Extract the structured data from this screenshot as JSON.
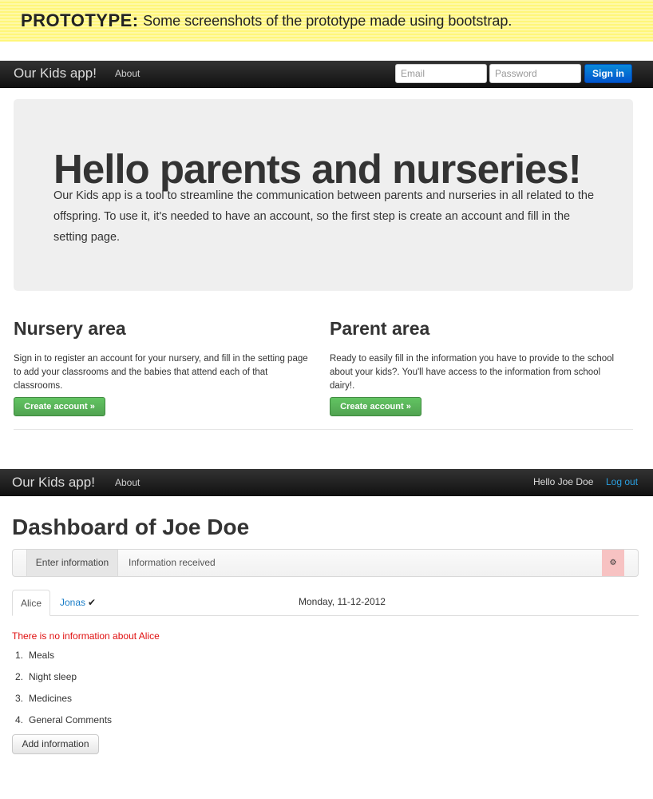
{
  "banner": {
    "title": "PROTOTYPE",
    "colon": ":",
    "text": "Some screenshots of the prototype made using bootstrap."
  },
  "nav1": {
    "brand": "Our Kids app!",
    "about": "About",
    "email_placeholder": "Email",
    "password_placeholder": "Password",
    "signin": "Sign in"
  },
  "hero": {
    "title": "Hello parents and nurseries!",
    "text": "Our Kids app is a tool to streamline the communication between parents and nurseries in all related to the offspring. To use it, it's needed to have an account, so the first step is create an account and fill in the setting page."
  },
  "nursery": {
    "title": "Nursery area",
    "text": "Sign in to register an account for your nursery, and fill in the setting page to add your classrooms and the babies that attend each of that classrooms.",
    "button": "Create account »"
  },
  "parent": {
    "title": "Parent area",
    "text": "Ready to easily fill in the information you have to provide to the school about your kids?. You'll have access to the information from school dairy!.",
    "button": "Create account »"
  },
  "nav2": {
    "brand": "Our Kids app!",
    "about": "About",
    "user": "Hello Joe Doe",
    "logout": "Log out"
  },
  "dashboard": {
    "title": "Dashboard of Joe Doe",
    "subnav": {
      "enter": "Enter information",
      "received": "Information received",
      "gear_icon": "gear-icon"
    },
    "tabs": {
      "alice": "Alice",
      "jonas": "Jonas",
      "jonas_check": "✔",
      "date": "Monday, 11-12-2012"
    },
    "no_info": "There is no information about Alice",
    "items": [
      {
        "num": "1.",
        "label": "Meals"
      },
      {
        "num": "2.",
        "label": "Night sleep"
      },
      {
        "num": "3.",
        "label": "Medicines"
      },
      {
        "num": "4.",
        "label": "General Comments"
      }
    ],
    "add_button": "Add information"
  },
  "colors": {
    "banner": "#fff67a",
    "navbar": "#1b1b1b",
    "signin": "#0055cc",
    "create_button": "#51a351",
    "link": "#1a7dc7",
    "error": "#e01010",
    "gear_bg": "#f7c2c2"
  }
}
